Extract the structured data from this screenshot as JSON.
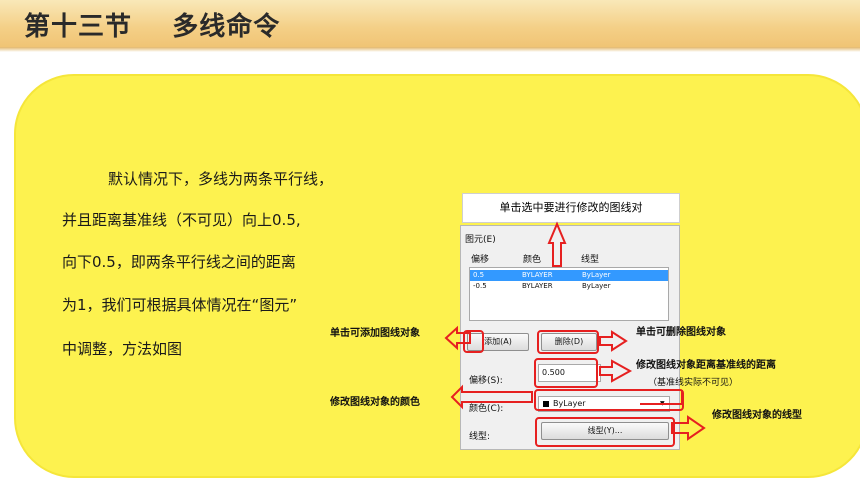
{
  "header": {
    "title": "第十三节    多线命令"
  },
  "paragraph": {
    "lines": [
      "默认情况下，多线为两条平行线，",
      "并且距离基准线（不可见）向上0.5,",
      "向下0.5，即两条平行线之间的距离",
      "为1，我们可根据具体情况在“图元”",
      "中调整，方法如图"
    ]
  },
  "dialog": {
    "caption": "单击选中要进行修改的图线对",
    "group_label": "图元(E)",
    "columns": [
      "偏移",
      "颜色",
      "线型"
    ],
    "rows": [
      {
        "offset": "0.5",
        "color": "BYLAYER",
        "linetype": "ByLayer"
      },
      {
        "offset": "-0.5",
        "color": "BYLAYER",
        "linetype": "ByLayer"
      }
    ],
    "add_button": "添加(A)",
    "delete_button": "删除(D)",
    "offset_label": "偏移(S):",
    "offset_value": "0.500",
    "color_label": "颜色(C):",
    "color_value": "ByLayer",
    "linetype_label": "线型:",
    "linetype_button": "线型(Y)..."
  },
  "annotations": {
    "add": "单击可添加图线对象",
    "delete": "单击可删除图线对象",
    "offset": "修改图线对象距离基准线的距离",
    "offset_note": "（基准线实际不可见）",
    "color": "修改图线对象的颜色",
    "linetype": "修改图线对象的线型"
  },
  "colors": {
    "panel": "#fdf24f",
    "header": "#f4cf86",
    "highlight": "#e62020",
    "selection": "#3399ff"
  }
}
